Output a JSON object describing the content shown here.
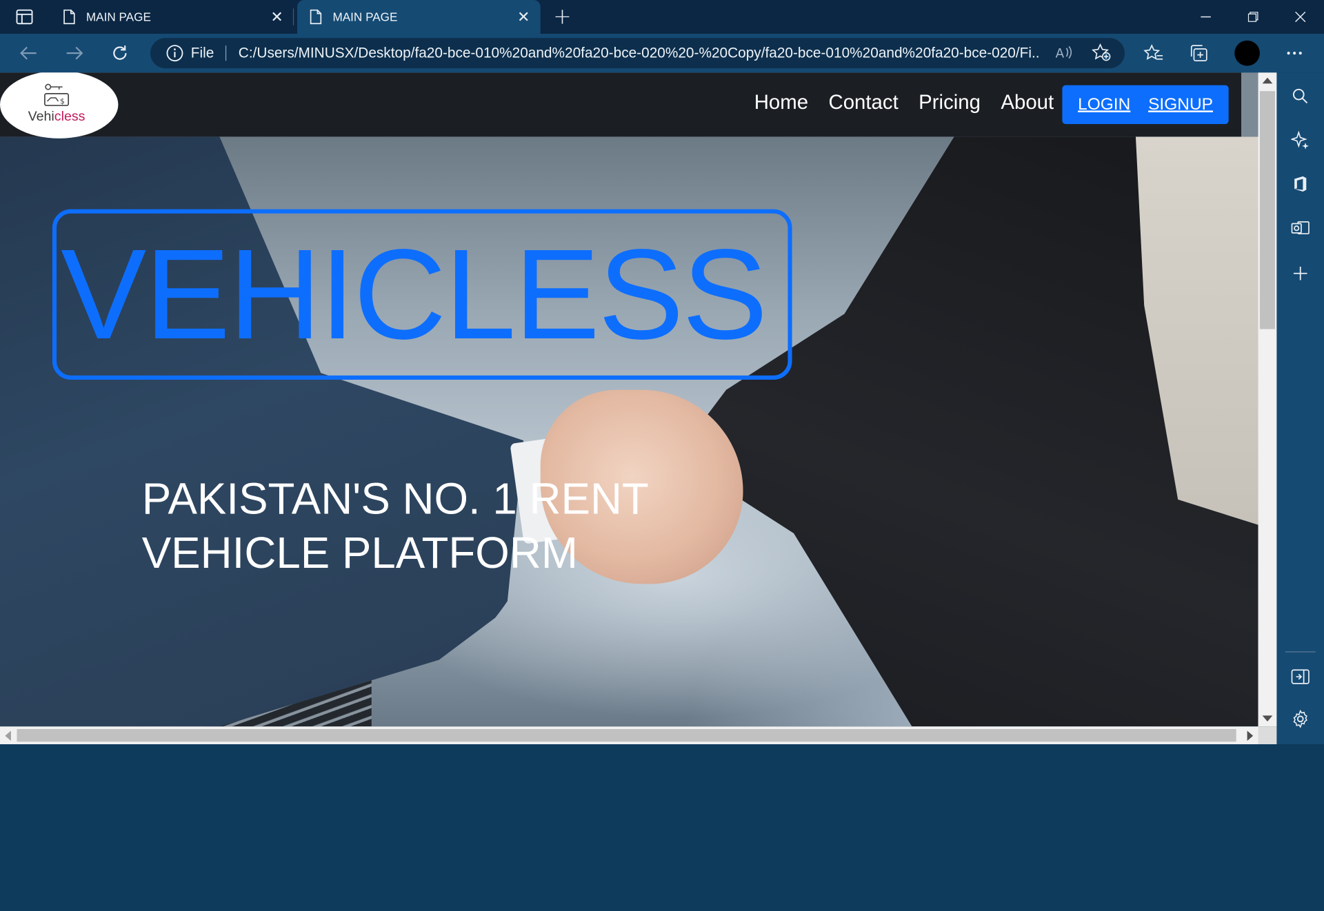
{
  "browser": {
    "tabs": [
      {
        "title": "MAIN PAGE",
        "active": false
      },
      {
        "title": "MAIN PAGE",
        "active": true
      }
    ],
    "address_bar": {
      "scheme_label": "File",
      "url": "C:/Users/MINUSX/Desktop/fa20-bce-010%20and%20fa20-bce-020%20-%20Copy/fa20-bce-010%20and%20fa20-bce-020/Fi..."
    },
    "icons": {
      "workspaces": "workspaces-icon",
      "back": "back-arrow-icon",
      "forward": "forward-arrow-icon",
      "refresh": "refresh-icon",
      "read_aloud": "read-aloud-icon",
      "add_favorite": "add-favorite-icon",
      "favorites": "favorites-icon",
      "collections": "collections-icon",
      "more": "more-icon"
    },
    "colors": {
      "titlebar": "#0b2744",
      "toolbar": "#154a73",
      "omnibox": "#0d2f4d"
    }
  },
  "site": {
    "logo": {
      "text_prefix": "Vehi",
      "text_accent": "cless"
    },
    "nav": [
      "Home",
      "Contact",
      "Pricing",
      "About"
    ],
    "auth": {
      "login": "LOGIN",
      "signup": "SIGNUP"
    },
    "hero": {
      "brand": "VEHICLESS",
      "tagline_line1": "PAKISTAN'S NO. 1 RENT",
      "tagline_line2": "VEHICLE PLATFORM"
    },
    "colors": {
      "accent": "#0d6efd",
      "header": "#1b1f24",
      "logo_accent": "#c2185b"
    }
  }
}
